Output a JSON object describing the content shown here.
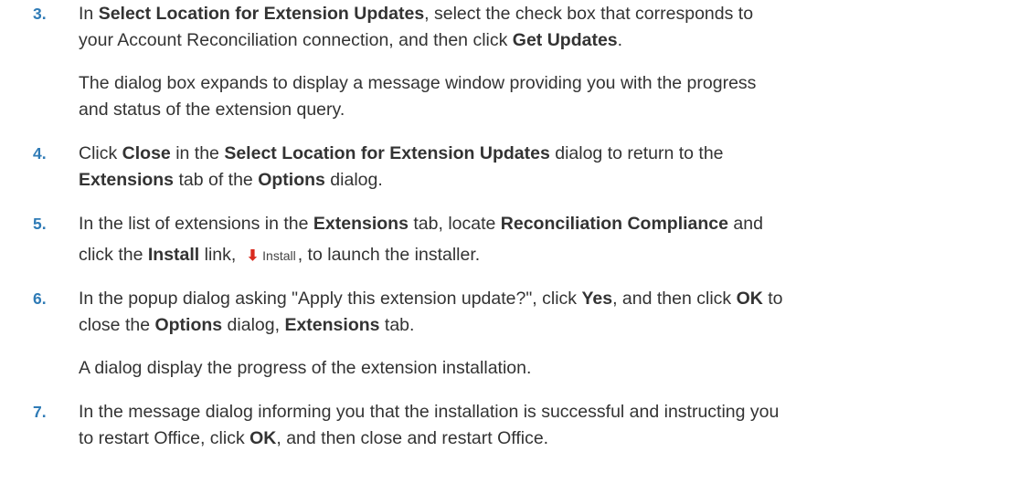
{
  "steps": {
    "s3": {
      "number": "3.",
      "l1_a": "In ",
      "l1_b": "Select Location for Extension Updates",
      "l1_c": ", select the check box that corresponds to",
      "l2_a": "your Account Reconciliation connection, and then click ",
      "l2_b": "Get Updates",
      "l2_c": ".",
      "p1": "The dialog box expands to display a message window providing you with the progress",
      "p2": "and status of the extension query."
    },
    "s4": {
      "number": "4.",
      "l1_a": "Click ",
      "l1_b": "Close",
      "l1_c": " in the ",
      "l1_d": "Select Location for Extension Updates",
      "l1_e": " dialog to return to the",
      "l2_a": "Extensions",
      "l2_b": " tab of the ",
      "l2_c": "Options",
      "l2_d": " dialog."
    },
    "s5": {
      "number": "5.",
      "l1_a": "In the list of extensions in the ",
      "l1_b": "Extensions",
      "l1_c": " tab, locate ",
      "l1_d": "Reconciliation Compliance",
      "l1_e": " and",
      "l2_a": "click the ",
      "l2_b": "Install",
      "l2_c": " link, ",
      "install_icon_label": "Install",
      "l2_d": ", to launch the installer."
    },
    "s6": {
      "number": "6.",
      "l1_a": "In the popup dialog asking \"Apply this extension update?\", click ",
      "l1_b": "Yes",
      "l1_c": ", and then click ",
      "l1_d": "OK",
      "l1_e": " to",
      "l2_a": "close the ",
      "l2_b": "Options",
      "l2_c": " dialog, ",
      "l2_d": "Extensions",
      "l2_e": " tab.",
      "p1": "A dialog display the progress of the extension installation."
    },
    "s7": {
      "number": "7.",
      "l1": "In the message dialog informing you that the installation is successful and instructing you",
      "l2_a": "to restart Office, click ",
      "l2_b": "OK",
      "l2_c": ", and then close and restart Office."
    }
  },
  "colors": {
    "step_number": "#2f7bb6",
    "body_text": "#333333",
    "install_arrow": "#d92b1f"
  },
  "icons": {
    "install": "download-arrow-icon"
  }
}
